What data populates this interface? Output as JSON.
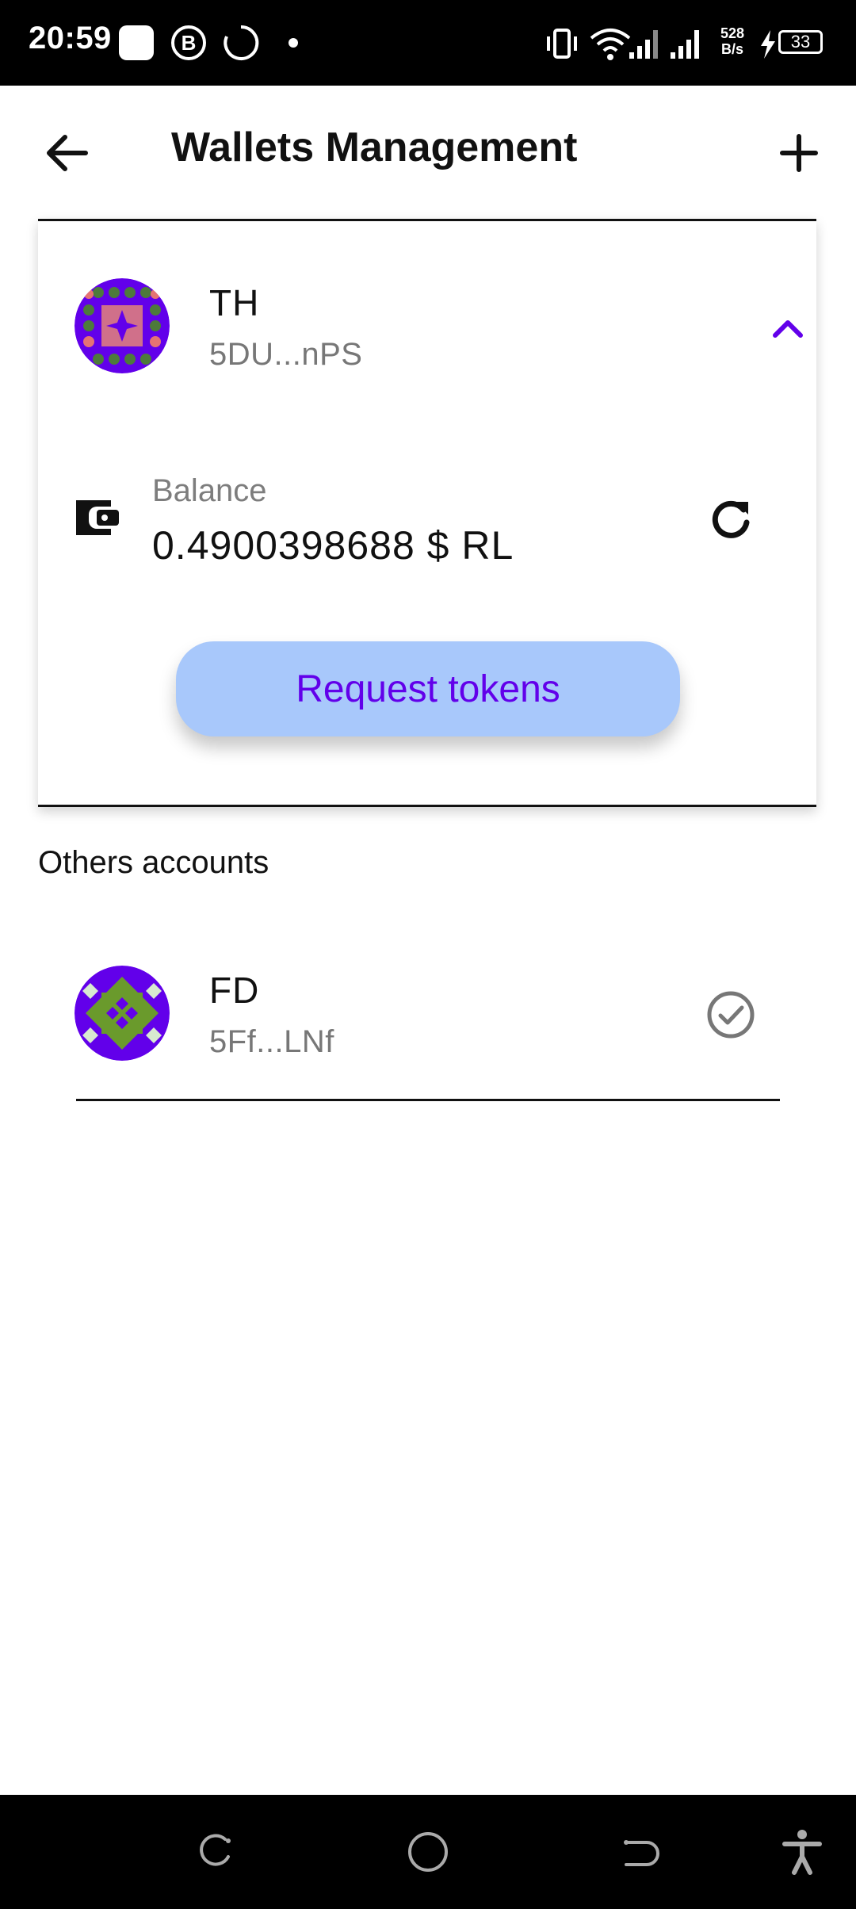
{
  "status_bar": {
    "time": "20:59",
    "net_speed_value": "528",
    "net_speed_unit": "B/s",
    "battery": "33",
    "icons": [
      "square-app-icon",
      "b-circle-icon",
      "loading-circle-icon",
      "dot-icon",
      "vibrate-icon",
      "wifi-icon",
      "signal-icon",
      "signal-icon-2",
      "charging-icon",
      "battery-icon"
    ]
  },
  "header": {
    "title": "Wallets Management",
    "back_icon": "back-arrow-icon",
    "add_icon": "plus-icon"
  },
  "current_wallet": {
    "name": "TH",
    "address": "5DU...nPS",
    "expanded": true,
    "balance_label": "Balance",
    "balance_value": "0.4900398688 $ RL",
    "request_button": "Request tokens",
    "colors": {
      "accent": "#6200ea",
      "button_bg": "#a8c8fb",
      "avatar_bg": "#6200ea"
    }
  },
  "others": {
    "title": "Others accounts",
    "accounts": [
      {
        "name": "FD",
        "address": "5Ff...LNf",
        "status_icon": "check-circle-icon"
      }
    ]
  },
  "nav_bar": {
    "icons": [
      "recents-icon",
      "home-icon",
      "back-icon",
      "accessibility-icon"
    ]
  }
}
